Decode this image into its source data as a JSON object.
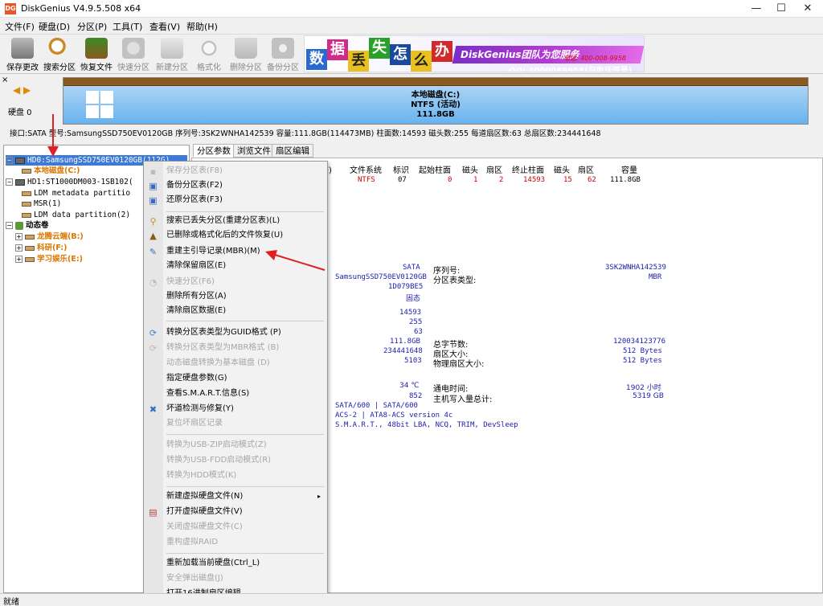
{
  "window": {
    "app_icon_text": "DG",
    "title": "DiskGenius V4.9.5.508 x64",
    "min": "—",
    "max": "☐",
    "close": "✕"
  },
  "menu": [
    "文件(F)",
    "硬盘(D)",
    "分区(P)",
    "工具(T)",
    "查看(V)",
    "帮助(H)"
  ],
  "toolbar": [
    {
      "label": "保存更改",
      "icon": "save-icon",
      "color": "#7a7a7a"
    },
    {
      "label": "搜索分区",
      "icon": "search-icon",
      "color": "#c98a2a"
    },
    {
      "label": "恢复文件",
      "icon": "recover-icon",
      "color": "#8a5a1c"
    },
    {
      "label": "快速分区",
      "icon": "quick-partition-icon",
      "color": "#9a9a9a"
    },
    {
      "label": "新建分区",
      "icon": "new-partition-icon",
      "color": "#9a9a9a"
    },
    {
      "label": "格式化",
      "icon": "format-icon",
      "color": "#9a9a9a"
    },
    {
      "label": "删除分区",
      "icon": "delete-icon",
      "color": "#9a9a9a"
    },
    {
      "label": "备份分区",
      "icon": "backup-icon",
      "color": "#9a9a9a"
    }
  ],
  "banner": {
    "chars": [
      "数",
      "据",
      "丢",
      "失",
      "怎",
      "么",
      "办"
    ],
    "brand": "DiskGenius团队为您服务",
    "service": "为您服务",
    "phone": "电话: 400-008-9958",
    "qq": "QQ: 4000089958(与电话同号)"
  },
  "disk_panel": {
    "close": "×",
    "nav": "◀ ▶",
    "disk_label": "硬盘 0",
    "partition_name": "本地磁盘(C:)",
    "partition_fs": "NTFS (活动)",
    "partition_size": "111.8GB"
  },
  "disk_info": "接口:SATA  型号:SamsungSSD750EV0120GB  序列号:3SK2WNHA142539  容量:111.8GB(114473MB)  柱面数:14593  磁头数:255  每道扇区数:63  总扇区数:234441648",
  "tree": {
    "hd0": "HD0:SamsungSSD750EV0120GB(112G)",
    "hd0_c": "本地磁盘(C:)",
    "hd1": "HD1:ST1000DM003-1SB102(",
    "ldm_meta": "LDM metadata partitio",
    "msr": "MSR(1)",
    "ldm_data": "LDM data partition(2)",
    "dynamic": "动态卷",
    "vol_b": "龙腾云端(B:)",
    "vol_f": "科研(F:)",
    "vol_e": "学习娱乐(E:)"
  },
  "tabs": [
    "分区参数",
    "浏览文件",
    "扇区编辑"
  ],
  "table": {
    "headers": [
      "态)",
      "文件系统",
      "标识",
      "起始柱面",
      "磁头",
      "扇区",
      "终止柱面",
      "磁头",
      "扇区",
      "容量"
    ],
    "row": [
      "NTFS",
      "07",
      "0",
      "1",
      "2",
      "14593",
      "15",
      "62",
      "111.8GB"
    ]
  },
  "details": {
    "sata": "SATA",
    "model": "SamsungSSD750EV0120GB",
    "id": "1D079BE5",
    "type": "固态",
    "serial_label": "序列号:",
    "serial_value": "3SK2WNHA142539",
    "pt_label": "分区表类型:",
    "pt_value": "MBR",
    "cyl": "14593",
    "heads": "255",
    "spt": "63",
    "cap": "111.8GB",
    "sectors": "234441648",
    "v5103": "5103",
    "total_bytes_label": "总字节数:",
    "total_bytes_value": "120034123776",
    "sector_size_label": "扇区大小:",
    "sector_size_value": "512 Bytes",
    "phys_sector_label": "物理扇区大小:",
    "phys_sector_value": "512 Bytes",
    "temp": "34 ℃",
    "v852": "852",
    "poweron_label": "通电时间:",
    "poweron_value": "1902 小时",
    "written_label": "主机写入量总计:",
    "written_value": "5319 GB",
    "iface": "SATA/600 | SATA/600",
    "acs": "ACS-2 | ATA8-ACS version 4c",
    "features": "S.M.A.R.T., 48bit LBA, NCQ, TRIM, DevSleep"
  },
  "context_menu": [
    {
      "label": "保存分区表(F8)",
      "disabled": true
    },
    {
      "label": "备份分区表(F2)",
      "disabled": false
    },
    {
      "label": "还原分区表(F3)",
      "disabled": false
    },
    {
      "label": "搜索已丢失分区(重建分区表)(L)",
      "disabled": false
    },
    {
      "label": "已删除或格式化后的文件恢复(U)",
      "disabled": false
    },
    {
      "label": "重建主引导记录(MBR)(M)",
      "disabled": false
    },
    {
      "label": "清除保留扇区(E)",
      "disabled": false
    },
    {
      "label": "快速分区(F6)",
      "disabled": true
    },
    {
      "label": "删除所有分区(A)",
      "disabled": false
    },
    {
      "label": "清除扇区数据(E)",
      "disabled": false
    },
    {
      "label": "转换分区表类型为GUID格式 (P)",
      "disabled": false
    },
    {
      "label": "转换分区表类型为MBR格式 (B)",
      "disabled": true
    },
    {
      "label": "动态磁盘转换为基本磁盘 (D)",
      "disabled": true
    },
    {
      "label": "指定硬盘参数(G)",
      "disabled": false
    },
    {
      "label": "查看S.M.A.R.T.信息(S)",
      "disabled": false
    },
    {
      "label": "坏道检测与修复(Y)",
      "disabled": false
    },
    {
      "label": "复位坏扇区记录",
      "disabled": true
    },
    {
      "label": "转换为USB-ZIP启动模式(Z)",
      "disabled": true
    },
    {
      "label": "转换为USB-FDD启动模式(R)",
      "disabled": true
    },
    {
      "label": "转换为HDD模式(K)",
      "disabled": true
    },
    {
      "label": "新建虚拟硬盘文件(N)",
      "disabled": false
    },
    {
      "label": "打开虚拟硬盘文件(V)",
      "disabled": false
    },
    {
      "label": "关闭虚拟硬盘文件(C)",
      "disabled": true
    },
    {
      "label": "重构虚拟RAID",
      "disabled": true
    },
    {
      "label": "重新加载当前硬盘(Ctrl_L)",
      "disabled": false
    },
    {
      "label": "安全弹出磁盘(J)",
      "disabled": true
    },
    {
      "label": "打开16进制扇区编辑",
      "disabled": false
    }
  ],
  "submenu_arrow": "▸",
  "status": "就绪",
  "colors": {
    "accent": "#3d7ad8",
    "partition_fill": "#69b2ee",
    "arrow": "#e02020",
    "orange": "#d97700"
  }
}
